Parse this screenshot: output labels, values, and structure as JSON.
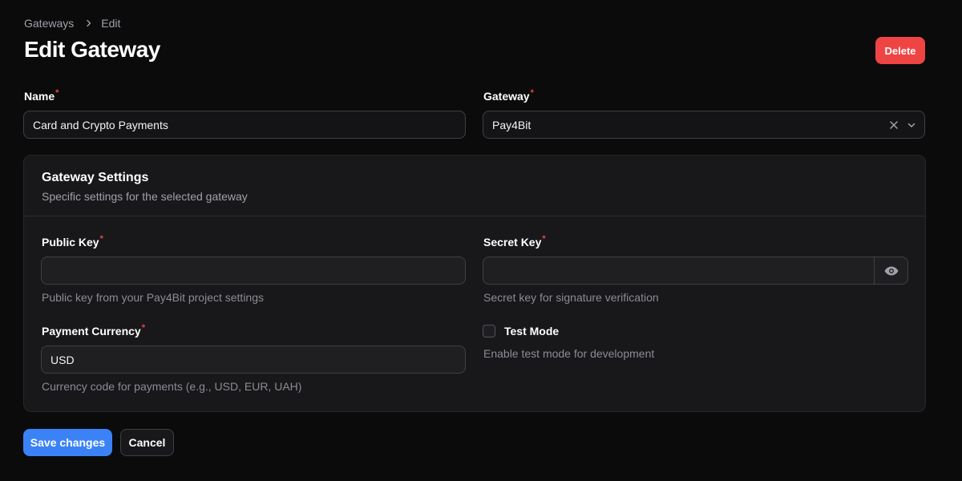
{
  "breadcrumb": {
    "parent": "Gateways",
    "current": "Edit",
    "separator_icon": "chevron-right-icon"
  },
  "page_title": "Edit Gateway",
  "header": {
    "delete_label": "Delete"
  },
  "form": {
    "name": {
      "label": "Name",
      "required_marker": "*",
      "value": "Card and Crypto Payments"
    },
    "gateway": {
      "label": "Gateway",
      "required_marker": "*",
      "value": "Pay4Bit",
      "clear_icon": "close-icon",
      "dropdown_icon": "chevron-down-icon"
    }
  },
  "settings": {
    "title": "Gateway Settings",
    "subtitle": "Specific settings for the selected gateway",
    "public_key": {
      "label": "Public Key",
      "required_marker": "*",
      "value": "",
      "hint": "Public key from your Pay4Bit project settings"
    },
    "secret_key": {
      "label": "Secret Key",
      "required_marker": "*",
      "value": "",
      "hint": "Secret key for signature verification",
      "reveal_icon": "eye-icon"
    },
    "payment_currency": {
      "label": "Payment Currency",
      "required_marker": "*",
      "value": "USD",
      "hint": "Currency code for payments (e.g., USD, EUR, UAH)"
    },
    "test_mode": {
      "label": "Test Mode",
      "checked": false,
      "hint": "Enable test mode for development"
    }
  },
  "actions": {
    "save_label": "Save changes",
    "cancel_label": "Cancel"
  },
  "colors": {
    "background": "#0b0b0c",
    "accent": "#3b82f6",
    "danger": "#ef4444",
    "card": "#18181b"
  }
}
